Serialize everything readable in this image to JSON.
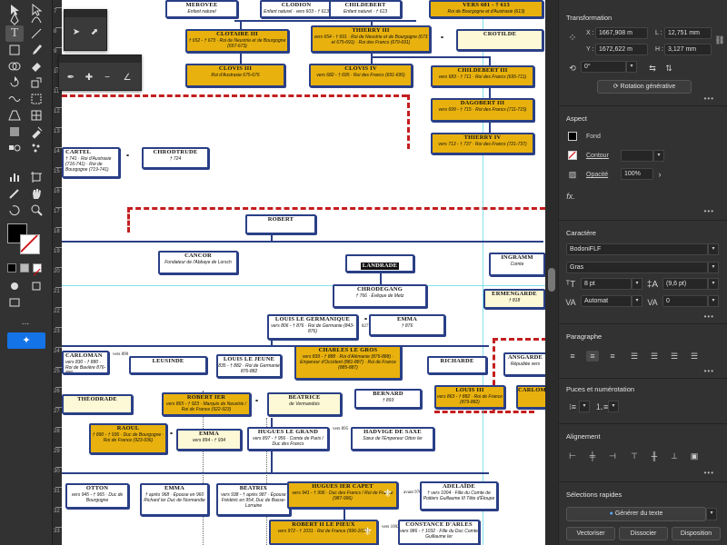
{
  "toolbar": {
    "tools": [
      "selection-icon",
      "direct-selection-icon",
      "pen-icon",
      "curvature-icon",
      "type-icon",
      "line-icon",
      "rectangle-icon",
      "brush-icon",
      "shape-builder-icon",
      "eraser-icon",
      "rotate-icon",
      "scale-icon",
      "warp-icon",
      "free-transform-icon",
      "perspective-icon",
      "mesh-icon",
      "gradient-icon",
      "eyedropper-icon",
      "blend-icon",
      "symbol-sprayer-icon",
      "graph-icon",
      "artboard-icon",
      "slice-icon",
      "hand-icon",
      "zoom-icon",
      "rotate-view-icon"
    ],
    "more": "..."
  },
  "ruler": {
    "numbers": [
      "7",
      "8",
      "9",
      "10",
      "11",
      "12",
      "13",
      "14",
      "15",
      "16",
      "17",
      "18",
      "19",
      "20",
      "21",
      "22",
      "23",
      "24",
      "25",
      "26",
      "27",
      "28",
      "29",
      "30",
      "31",
      "32",
      "33"
    ]
  },
  "tree": {
    "nodes": [
      {
        "name": "MEROVEE",
        "sub": "Enfant naturel",
        "style": "plain"
      },
      {
        "name": "CLODION",
        "sub": "Enfant naturel · vers 603 - † 613",
        "style": "plain"
      },
      {
        "name": "CHILDEBERT",
        "sub": "Enfant naturel · † 613",
        "style": "plain"
      },
      {
        "name": "vers 601 - † 613",
        "sub": "Roi de Bourgogne et d'Austrasie (613)",
        "style": "gold"
      },
      {
        "name": "CLOTAIRE III",
        "sub": "† 652 - † 673 · Roi de Neustrie et de Bourgogne (657-673)",
        "style": "gold"
      },
      {
        "name": "THIERRY III",
        "sub": "vers 654 - † 691 · Roi de Neustrie et de Bourgogne (673 et 675-691) · Roi des Francs (679-691)",
        "style": "gold"
      },
      {
        "name": "CROTILDE",
        "sub": "",
        "style": "cream"
      },
      {
        "name": "CLOVIS III",
        "sub": "Roi d'Austrasie 675-676",
        "style": "gold"
      },
      {
        "name": "CLOVIS IV",
        "sub": "vers 682 - † 695 · Roi des Francs (691-695)",
        "style": "gold"
      },
      {
        "name": "CHILDEBERT III",
        "sub": "vers 683 - † 711 · Roi des Francs (695-711)",
        "style": "gold"
      },
      {
        "name": "DAGOBERT III",
        "sub": "vers 699 - † 715 · Roi des Francs (711-715)",
        "style": "gold"
      },
      {
        "name": "THIERRY IV",
        "sub": "vers 713 - † 737 · Roi des Francs (721-737)",
        "style": "gold"
      },
      {
        "name": "CARTEL",
        "sub": "† 741 · Roi d'Austrasie (716-741) · Roi de Bourgogne (719-741)",
        "style": "plain"
      },
      {
        "name": "CHRODTRUDE",
        "sub": "† 724",
        "style": "plain"
      },
      {
        "name": "ROBERT",
        "sub": "",
        "style": "plain"
      },
      {
        "name": "CANCOR",
        "sub": "Fondateur de l'Abbaye de Lorsch",
        "style": "plain"
      },
      {
        "name": "LANDRADE",
        "sub": "",
        "style": "dark"
      },
      {
        "name": "INGRAMM",
        "sub": "Comte",
        "style": "plain"
      },
      {
        "name": "CHRODEGANG",
        "sub": "† 766 · Évêque de Metz",
        "style": "plain"
      },
      {
        "name": "ERMENGARDE",
        "sub": "† 818",
        "style": "cream"
      },
      {
        "name": "LOUIS le Germanique",
        "sub": "vers 806 - † 876 · Roi de Germanie (843-876)",
        "style": "plain"
      },
      {
        "name": "EMMA",
        "sub": "† 876",
        "style": "plain"
      },
      {
        "name": "CARLOMAN",
        "sub": "vers 830 - † 880 · Roi de Bavière 876-880",
        "style": "plain"
      },
      {
        "name": "LEUSINDE",
        "sub": "",
        "style": "plain"
      },
      {
        "name": "LOUIS le Jeune",
        "sub": "835 - † 882 · Roi de Germanie 876-882",
        "style": "plain"
      },
      {
        "name": "CHARLES le Gros",
        "sub": "vers 839 - † 888 · Roi d'Alémanie (876-888) · Empereur d'Occident (881-887) · Roi de France (885-887)",
        "style": "gold"
      },
      {
        "name": "RICHARDE",
        "sub": "",
        "style": "plain"
      },
      {
        "name": "ANSGARDE",
        "sub": "Répudiée vers",
        "style": "plain"
      },
      {
        "name": "THÉODRADE",
        "sub": "",
        "style": "plain"
      },
      {
        "name": "ROBERT Ier",
        "sub": "vers 865 - † 923 · Marquis de Neustrie / Roi de France (922-923)",
        "style": "gold"
      },
      {
        "name": "BEATRICE",
        "sub": "de Vermandois",
        "style": "cream"
      },
      {
        "name": "BERNARD",
        "sub": "† 893",
        "style": "plain"
      },
      {
        "name": "LOUIS III",
        "sub": "vers 863 - † 882 · Roi de France (879-882)",
        "style": "gold"
      },
      {
        "name": "CARLOMAN",
        "sub": "",
        "style": "gold"
      },
      {
        "name": "RAOUL",
        "sub": "† 890 - † 936 · Duc de Bourgogne · Roi de France (923-936)",
        "style": "gold"
      },
      {
        "name": "EMMA",
        "sub": "vers 894 - † 934",
        "style": "cream"
      },
      {
        "name": "HUGUES le Grand",
        "sub": "vers 897 - † 956 · Comte de Paris / Duc des Francs",
        "style": "plain"
      },
      {
        "name": "HADVIGE de SAXE",
        "sub": "Sœur de l'Empereur Otton Ier",
        "style": "plain"
      },
      {
        "name": "OTTON",
        "sub": "vers 945 - † 965 · Duc de Bourgogne",
        "style": "plain"
      },
      {
        "name": "EMMA",
        "sub": "† après 968 · Épouse en 960 Richard Ier Duc de Normandie",
        "style": "plain"
      },
      {
        "name": "BEATRIX",
        "sub": "vers 938 - † après 987 · Épouse Frédéric en 954, Duc de Basse-Lorraine",
        "style": "plain"
      },
      {
        "name": "HUGUES Ier CAPET",
        "sub": "vers 941 - † 996 · Duc des Francs / Roi de France (987-996)",
        "style": "gold"
      },
      {
        "name": "ADELAÏDE",
        "sub": "† vers 1004 · Fille du Comte de Poitiers Guillaume III Tête d'Étoupe",
        "style": "plain"
      },
      {
        "name": "ROBERT II le Pieux",
        "sub": "vers 972 - † 1031 · Roi de France (996-1031)",
        "style": "gold"
      },
      {
        "name": "CONSTANCE d'Arles",
        "sub": "vers 986 - † 1032 · Fille du Duc Comte Guillaume Ier",
        "style": "plain"
      }
    ],
    "marriages": [
      "vers 890",
      "827",
      "vers 887",
      "vers 895",
      "avant 970",
      "vers 1002"
    ]
  },
  "panel": {
    "transformation": {
      "title": "Transformation",
      "x_label": "X :",
      "x_value": "1667,908 m",
      "y_label": "Y :",
      "y_value": "1672,622 m",
      "l_label": "L :",
      "l_value": "12,751 mm",
      "h_label": "H :",
      "h_value": "3,127 mm",
      "rotate_value": "0°",
      "generative_rotation": "Rotation générative"
    },
    "aspect": {
      "title": "Aspect",
      "fill_label": "Fond",
      "stroke_label": "Contour",
      "opacity_label": "Opacité",
      "opacity_value": "100%",
      "fill_color": "#000000"
    },
    "character": {
      "title": "Caractère",
      "font": "BodoniFLF",
      "style": "Gras",
      "size": "8 pt",
      "leading": "(9,6 pt)",
      "kerning": "Automat",
      "tracking": "0"
    },
    "paragraph": {
      "title": "Paragraphe"
    },
    "bullets": {
      "title": "Puces et numérotation"
    },
    "align": {
      "title": "Alignement"
    },
    "quick": {
      "title": "Sélections rapides",
      "generate_text": "Générer du texte",
      "vectorize": "Vectoriser",
      "ungroup": "Dissocier",
      "arrange": "Disposition"
    }
  }
}
